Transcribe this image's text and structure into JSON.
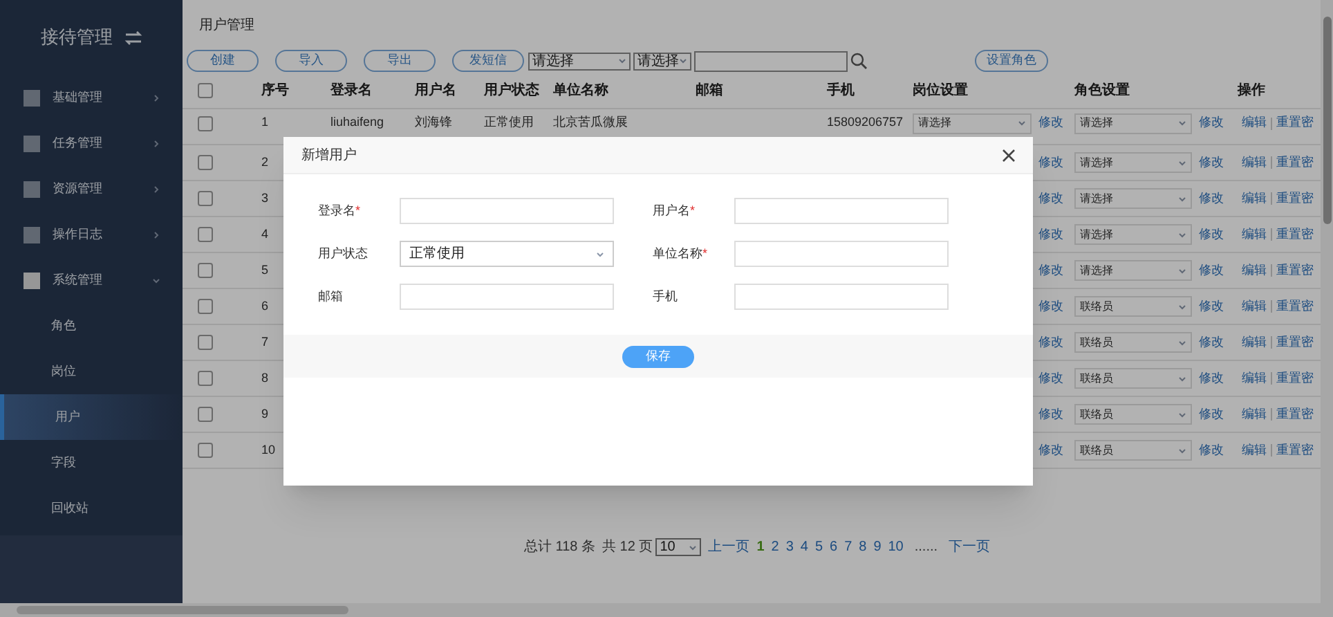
{
  "sidebar": {
    "title": "接待管理",
    "menu": [
      {
        "label": "基础管理",
        "expanded": false
      },
      {
        "label": "任务管理",
        "expanded": false
      },
      {
        "label": "资源管理",
        "expanded": false
      },
      {
        "label": "操作日志",
        "expanded": false
      },
      {
        "label": "系统管理",
        "expanded": true,
        "children": [
          {
            "label": "角色",
            "selected": false
          },
          {
            "label": "岗位",
            "selected": false
          },
          {
            "label": "用户",
            "selected": true
          },
          {
            "label": "字段",
            "selected": false
          },
          {
            "label": "回收站",
            "selected": false
          }
        ]
      }
    ]
  },
  "page_title": "用户管理",
  "toolbar": {
    "buttons": [
      "创建",
      "导入",
      "导出",
      "发短信"
    ],
    "filters": [
      "请选择",
      "请选择"
    ],
    "role_button": "设置角色"
  },
  "table": {
    "all_checked": false,
    "columns": [
      "序号",
      "登录名",
      "用户名",
      "用户状态",
      "单位名称",
      "邮箱",
      "手机",
      "岗位设置",
      "角色设置",
      "操作"
    ],
    "rows": [
      {
        "checked": false,
        "index": "1",
        "login": "liuhaifeng",
        "name": "刘海锋",
        "status": "正常使用",
        "unit": "北京苦瓜微展",
        "phone": "15809206757",
        "post": "请选择",
        "post_action": "修改",
        "role": "请选择",
        "role_action": "修改",
        "edit": "编辑",
        "reset": "重置密"
      },
      {
        "checked": false,
        "index": "2",
        "post_action": "修改",
        "role": "请选择",
        "role_action": "修改",
        "edit": "编辑",
        "reset": "重置密"
      },
      {
        "checked": false,
        "index": "3",
        "post_action": "修改",
        "role": "请选择",
        "role_action": "修改",
        "edit": "编辑",
        "reset": "重置密"
      },
      {
        "checked": false,
        "index": "4",
        "post_action": "修改",
        "role": "请选择",
        "role_action": "修改",
        "edit": "编辑",
        "reset": "重置密"
      },
      {
        "checked": false,
        "index": "5",
        "post_action": "修改",
        "role": "请选择",
        "role_action": "修改",
        "edit": "编辑",
        "reset": "重置密"
      },
      {
        "checked": false,
        "index": "6",
        "post_action": "修改",
        "role": "联络员",
        "role_action": "修改",
        "edit": "编辑",
        "reset": "重置密"
      },
      {
        "checked": false,
        "index": "7",
        "post_action": "修改",
        "role": "联络员",
        "role_action": "修改",
        "edit": "编辑",
        "reset": "重置密"
      },
      {
        "checked": false,
        "index": "8",
        "post_action": "修改",
        "role": "联络员",
        "role_action": "修改",
        "edit": "编辑",
        "reset": "重置密"
      },
      {
        "checked": false,
        "index": "9",
        "post_action": "修改",
        "role": "联络员",
        "role_action": "修改",
        "edit": "编辑",
        "reset": "重置密"
      },
      {
        "checked": false,
        "index": "10",
        "post_action": "修改",
        "role": "联络员",
        "role_action": "修改",
        "edit": "编辑",
        "reset": "重置密"
      }
    ]
  },
  "pagination": {
    "total": "总计 118 条",
    "pages": "共 12 页",
    "page_size": "10",
    "prev": "上一页",
    "page_numbers": [
      {
        "label": "1",
        "selected": true
      },
      {
        "label": "2",
        "selected": false
      },
      {
        "label": "3",
        "selected": false
      },
      {
        "label": "4",
        "selected": false
      },
      {
        "label": "5",
        "selected": false
      },
      {
        "label": "6",
        "selected": false
      },
      {
        "label": "7",
        "selected": false
      },
      {
        "label": "8",
        "selected": false
      },
      {
        "label": "9",
        "selected": false
      },
      {
        "label": "10",
        "selected": false
      }
    ],
    "ellipsis": "......",
    "next": "下一页"
  },
  "dialog": {
    "title": "新增用户",
    "fields": [
      {
        "kind": "input",
        "label": "登录名",
        "marker": "*"
      },
      {
        "kind": "input",
        "label": "用户名",
        "marker": "*"
      },
      {
        "kind": "select",
        "label": "用户状态",
        "value": "正常使用"
      },
      {
        "kind": "input",
        "label": "单位名称",
        "marker": "*"
      },
      {
        "kind": "input",
        "label": "邮箱"
      },
      {
        "kind": "input",
        "label": "手机"
      }
    ],
    "save_button": "保存"
  }
}
